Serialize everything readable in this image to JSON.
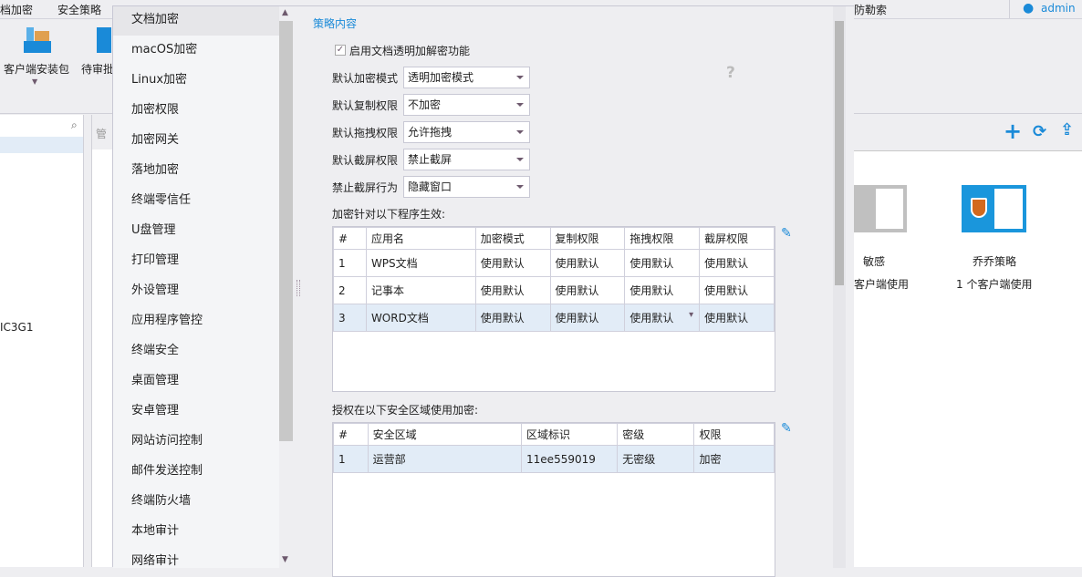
{
  "background_app": {
    "menu": [
      "档加密",
      "安全策略"
    ],
    "menu_right": "防勒索",
    "user": "admin",
    "ribbon": [
      {
        "label": "客户端安装包"
      },
      {
        "label": "待审批"
      }
    ],
    "tree_item": "IC3G1",
    "column_header": "管",
    "policies": [
      {
        "name": "敏感",
        "usage": "客户端使用"
      },
      {
        "name": "乔乔策略",
        "usage": "1 个客户端使用"
      }
    ]
  },
  "nav": {
    "items": [
      "文档加密",
      "macOS加密",
      "Linux加密",
      "加密权限",
      "加密网关",
      "落地加密",
      "终端零信任",
      "U盘管理",
      "打印管理",
      "外设管理",
      "应用程序管控",
      "终端安全",
      "桌面管理",
      "安卓管理",
      "网站访问控制",
      "邮件发送控制",
      "终端防火墙",
      "本地审计",
      "网络审计"
    ],
    "selected": 0
  },
  "content": {
    "section_title": "策略内容",
    "enable_label": "启用文档透明加解密功能",
    "enable_checked": true,
    "fields": [
      {
        "label": "默认加密模式",
        "value": "透明加密模式",
        "help": "?"
      },
      {
        "label": "默认复制权限",
        "value": "不加密"
      },
      {
        "label": "默认拖拽权限",
        "value": "允许拖拽"
      },
      {
        "label": "默认截屏权限",
        "value": "禁止截屏"
      },
      {
        "label": "禁止截屏行为",
        "value": "隐藏窗口"
      }
    ],
    "programs_label": "加密针对以下程序生效:",
    "programs": {
      "headers": [
        "#",
        "应用名",
        "加密模式",
        "复制权限",
        "拖拽权限",
        "截屏权限"
      ],
      "rows": [
        [
          "1",
          "WPS文档",
          "使用默认",
          "使用默认",
          "使用默认",
          "使用默认"
        ],
        [
          "2",
          "记事本",
          "使用默认",
          "使用默认",
          "使用默认",
          "使用默认"
        ],
        [
          "3",
          "WORD文档",
          "使用默认",
          "使用默认",
          "使用默认",
          "使用默认"
        ]
      ],
      "selected_row": 2
    },
    "zones_label": "授权在以下安全区域使用加密:",
    "zones": {
      "headers": [
        "#",
        "安全区域",
        "区域标识",
        "密级",
        "权限"
      ],
      "rows": [
        [
          "1",
          "运营部",
          "11ee559019",
          "无密级",
          "加密"
        ]
      ],
      "selected_row": 0
    }
  },
  "colors": {
    "accent": "#1a8ad8",
    "selected_row": "#e2ecf7",
    "shield": "#d2691e"
  }
}
